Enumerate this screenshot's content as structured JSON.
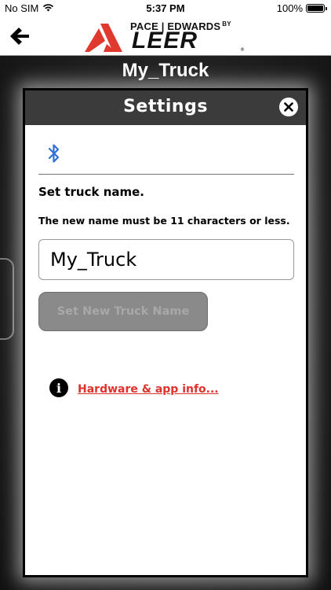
{
  "status_bar": {
    "carrier": "No SIM",
    "time": "5:37 PM",
    "battery": "100%",
    "wifi_icon": "wifi-icon",
    "battery_icon": "battery-full-icon"
  },
  "header": {
    "back_icon": "arrow-left-icon",
    "logo_line1": "PACE | EDWARDS",
    "logo_by": "BY",
    "logo_brand": "LEER",
    "logo_reg": "®"
  },
  "page": {
    "title": "My_Truck"
  },
  "dialog": {
    "title": "Settings",
    "close_icon": "close-icon",
    "bluetooth_icon": "bluetooth-icon",
    "heading": "Set truck name.",
    "note": "The new name must be 11 characters or less.",
    "name_input_value": "My_Truck",
    "set_button_label": "Set New Truck Name",
    "info_icon": "info-icon",
    "info_glyph": "i",
    "hardware_link": "Hardware & app info..."
  },
  "colors": {
    "link": "#e0322c",
    "bluetooth": "#2f6fd6",
    "dialog_header": "#3b3b3b",
    "logo_red": "#e03a2f"
  }
}
